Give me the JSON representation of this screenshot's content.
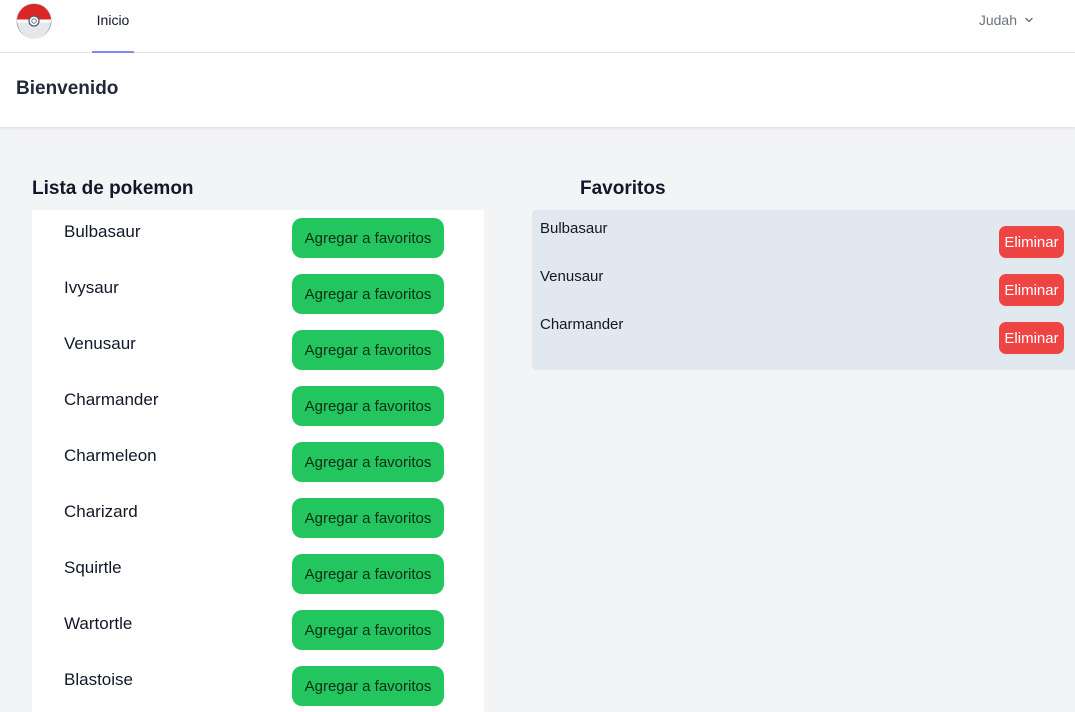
{
  "nav": {
    "logo_icon": "pokeball-icon",
    "links": [
      {
        "label": "Inicio",
        "active": true
      }
    ],
    "user": {
      "name": "Judah",
      "icon": "chevron-down-icon"
    },
    "active_color": "#818cf8"
  },
  "header": {
    "title": "Bienvenido"
  },
  "pokemon_list": {
    "title": "Lista de pokemon",
    "button_label": "Agregar a favoritos",
    "button_color": "#22c55e",
    "items": [
      "Bulbasaur",
      "Ivysaur",
      "Venusaur",
      "Charmander",
      "Charmeleon",
      "Charizard",
      "Squirtle",
      "Wartortle",
      "Blastoise"
    ]
  },
  "favorites": {
    "title": "Favoritos",
    "button_label": "Eliminar",
    "button_color": "#ef4444",
    "items": [
      "Bulbasaur",
      "Venusaur",
      "Charmander"
    ]
  }
}
